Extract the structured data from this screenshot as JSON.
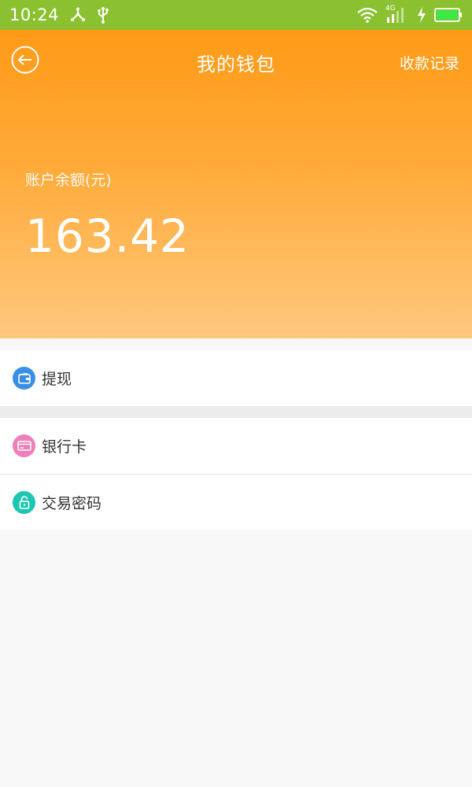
{
  "status_bar": {
    "time": "10:24",
    "network_label": "4G",
    "icons": [
      "share-icon",
      "usb-icon",
      "wifi-icon",
      "signal-icon",
      "charging-icon",
      "battery-icon"
    ]
  },
  "header": {
    "title": "我的钱包",
    "right_action": "收款记录",
    "back_icon": "back-arrow-icon"
  },
  "balance": {
    "label": "账户余额(元)",
    "amount": "163.42"
  },
  "menu": {
    "withdraw": {
      "label": "提现",
      "icon": "wallet-icon",
      "color": "#3a8ee6"
    },
    "bank_card": {
      "label": "银行卡",
      "icon": "card-icon",
      "color": "#ef7fb8"
    },
    "trade_password": {
      "label": "交易密码",
      "icon": "lock-icon",
      "color": "#1dc6b1"
    }
  },
  "colors": {
    "status_bar": "#8bc131",
    "hero_top": "#ff9a16",
    "hero_bottom": "#ffc87e"
  }
}
